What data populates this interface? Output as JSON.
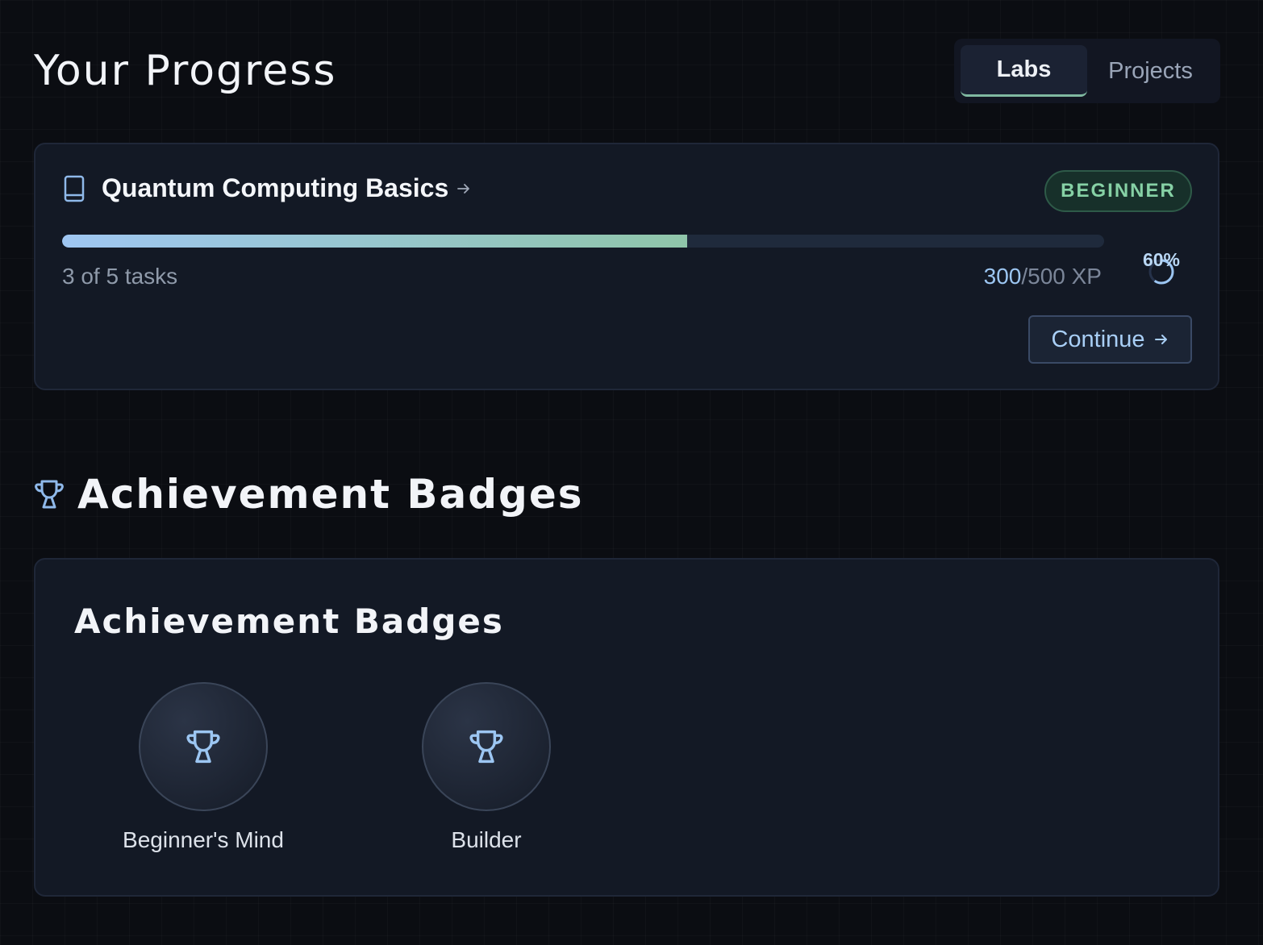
{
  "header": {
    "title": "Your Progress"
  },
  "tabs": [
    {
      "label": "Labs",
      "active": true
    },
    {
      "label": "Projects",
      "active": false
    }
  ],
  "course": {
    "icon": "book-icon",
    "title": "Quantum Computing Basics",
    "level": "BEGINNER",
    "progress_fraction": 0.6,
    "tasks_text": "3 of 5 tasks",
    "xp_current": "300",
    "xp_total": "/500 XP",
    "percent_label": "60%",
    "continue_label": "Continue"
  },
  "achievements": {
    "section_icon": "trophy-icon",
    "section_title": "Achievement Badges",
    "card_title": "Achievement Badges",
    "badges": [
      {
        "name": "Beginner's Mind",
        "icon": "trophy-icon"
      },
      {
        "name": "Builder",
        "icon": "trophy-icon"
      }
    ]
  },
  "colors": {
    "background": "#0b0d12",
    "card": "#131925",
    "accent_blue": "#9cc6f2",
    "accent_green": "#86d1a5"
  }
}
